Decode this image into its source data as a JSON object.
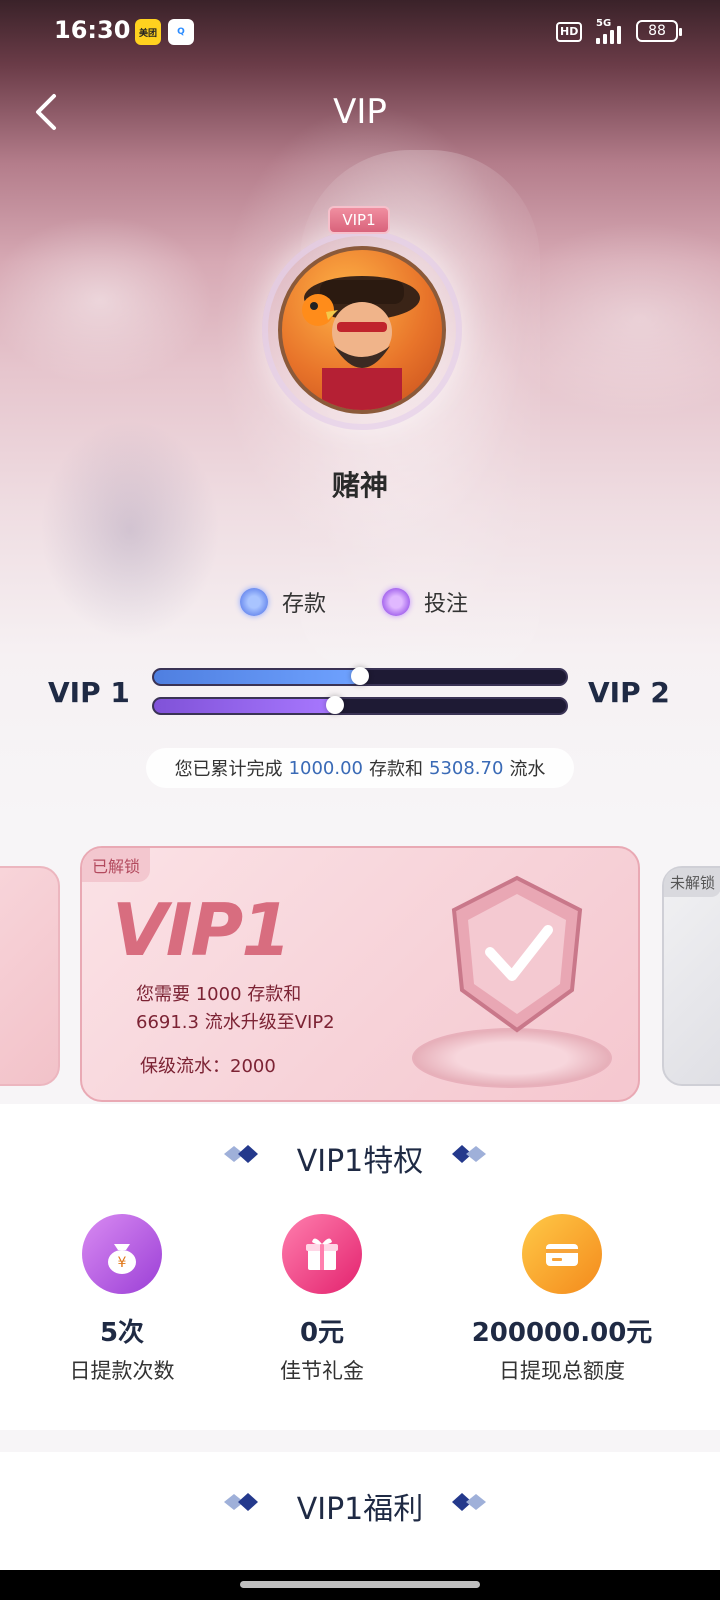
{
  "status_bar": {
    "time": "16:30",
    "badge1": "美团",
    "badge2": "Q",
    "hd": "HD",
    "network": "5G",
    "battery": "88"
  },
  "header": {
    "back_icon": "chevron-left-icon",
    "title": "VIP"
  },
  "profile": {
    "vip_tag": "VIP1",
    "username": "赌神"
  },
  "legend": {
    "deposit": "存款",
    "bet": "投注"
  },
  "progress": {
    "current_level": "VIP 1",
    "next_level": "VIP 2",
    "deposit_fraction": 0.5,
    "bet_fraction": 0.44
  },
  "summary": {
    "prefix": "您已累计完成",
    "deposit": "1000.00",
    "mid": "存款和",
    "turnover": "5308.70",
    "suffix": "流水"
  },
  "card": {
    "tag": "已解锁",
    "level": "VIP1",
    "line1": "您需要 1000 存款和",
    "line2": "6691.3 流水升级至VIP2",
    "keep": "保级流水：2000",
    "right_tag": "未解锁"
  },
  "privileges": {
    "title": "VIP1特权",
    "items": [
      {
        "value": "5次",
        "label": "日提款次数",
        "icon": "money-bag-icon"
      },
      {
        "value": "0元",
        "label": "佳节礼金",
        "icon": "gift-icon"
      },
      {
        "value": "200000.00元",
        "label": "日提现总额度",
        "icon": "card-icon"
      }
    ]
  },
  "benefits": {
    "title": "VIP1福利"
  }
}
